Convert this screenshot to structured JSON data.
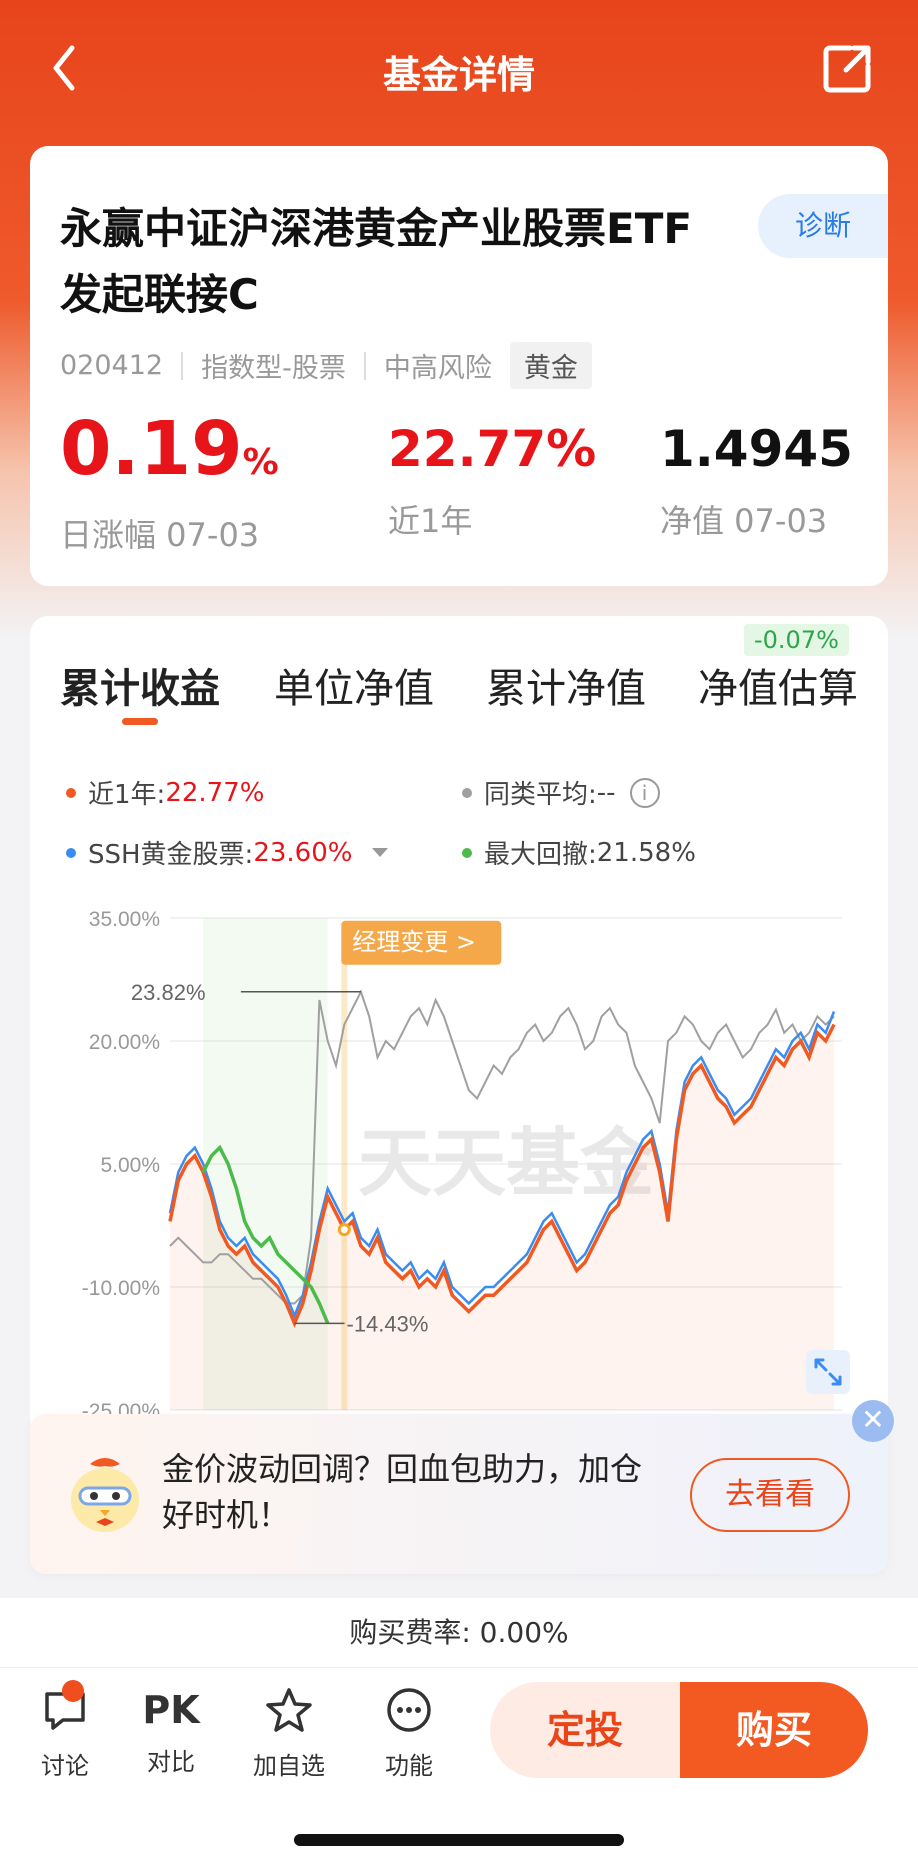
{
  "header": {
    "title": "基金详情"
  },
  "fund": {
    "name": "永赢中证沪深港黄金产业股票ETF发起联接C",
    "code": "020412",
    "type": "指数型-股票",
    "risk": "中高风险",
    "tag": "黄金",
    "diagnose_label": "诊断",
    "daily_change": "0.19",
    "daily_change_unit": "%",
    "daily_change_label": "日涨幅 07-03",
    "year_return": "22.77%",
    "year_return_label": "近1年",
    "nav": "1.4945",
    "nav_label": "净值 07-03"
  },
  "chart_tabs": {
    "tabs": [
      "累计收益",
      "单位净值",
      "累计净值",
      "净值估算"
    ],
    "active": 0,
    "estimate_badge": "-0.07%"
  },
  "legend": {
    "fund_label": "近1年:",
    "fund_value": "22.77%",
    "peer_label": "同类平均:",
    "peer_value": "--",
    "index_label": "SSH黄金股票:",
    "index_value": "23.60%",
    "drawdown_label": "最大回撤:",
    "drawdown_value": "21.58%"
  },
  "chart_data": {
    "type": "line",
    "y_ticks": [
      "35.00%",
      "20.00%",
      "5.00%",
      "-10.00%",
      "-25.00%"
    ],
    "ylim": [
      -25,
      35
    ],
    "annotations": {
      "manager_change": "经理变更 >",
      "max_label": "23.82%",
      "min_label": "-14.43%",
      "watermark": "天天基金"
    },
    "colors": {
      "fund": "#f05a22",
      "index": "#3b8cf0",
      "peer": "#a0a0a0",
      "drawdown": "#4cbb4c"
    },
    "series": [
      {
        "name": "近1年",
        "values": [
          -2,
          3,
          5,
          6,
          4,
          1,
          -3,
          -5,
          -6,
          -5,
          -7,
          -8,
          -9,
          -10,
          -12,
          -14.43,
          -12,
          -8,
          -3,
          1,
          -1,
          -3,
          -2,
          -5,
          -6,
          -4,
          -7,
          -8,
          -9,
          -8,
          -10,
          -9,
          -10,
          -8,
          -11,
          -12,
          -13,
          -12,
          -11,
          -11,
          -10,
          -9,
          -8,
          -7,
          -5,
          -3,
          -2,
          -4,
          -6,
          -8,
          -7,
          -5,
          -3,
          -1,
          0,
          3,
          5,
          7,
          8,
          4,
          -2,
          8,
          14,
          16,
          17,
          15,
          13,
          12,
          10,
          11,
          12,
          14,
          16,
          18,
          17,
          19,
          20,
          18,
          21,
          20,
          22
        ]
      },
      {
        "name": "SSH黄金股票",
        "values": [
          -1,
          4,
          6,
          7,
          5,
          2,
          -2,
          -4,
          -5,
          -4,
          -6,
          -7,
          -8,
          -9,
          -11,
          -13.5,
          -11,
          -7,
          -2,
          2,
          0,
          -2,
          -1,
          -4,
          -5,
          -3,
          -6,
          -7,
          -8,
          -7,
          -9,
          -8,
          -9,
          -7,
          -10,
          -11,
          -12,
          -11,
          -10,
          -10,
          -9,
          -8,
          -7,
          -6,
          -4,
          -2,
          -1,
          -3,
          -5,
          -7,
          -6,
          -4,
          -2,
          0,
          1,
          4,
          6,
          8,
          9,
          5,
          -1,
          9,
          15,
          17,
          18,
          16,
          14,
          13,
          11,
          12,
          13,
          15,
          17,
          19,
          18,
          20,
          21,
          19,
          22,
          21,
          23.6
        ]
      },
      {
        "name": "同类平均",
        "values": [
          -5,
          -4,
          -5,
          -6,
          -7,
          -7,
          -6,
          -6,
          -7,
          -8,
          -9,
          -9,
          -10,
          -11,
          -12,
          -12,
          -11,
          -4,
          25,
          20,
          17,
          22,
          24,
          26,
          23,
          18,
          20,
          19,
          21,
          23,
          24,
          22,
          25,
          23,
          20,
          17,
          14,
          13,
          15,
          17,
          16,
          18,
          19,
          21,
          22,
          20,
          21,
          23,
          24,
          22,
          19,
          20,
          23,
          24,
          22,
          21,
          17,
          15,
          13,
          10,
          20,
          21,
          23,
          22,
          20,
          19,
          21,
          22,
          20,
          18,
          19,
          21,
          22,
          23.82,
          21,
          22,
          20,
          21,
          23,
          22,
          23
        ]
      },
      {
        "name": "最大回撤",
        "values": [
          4,
          6,
          7,
          5,
          2,
          -2,
          -4,
          -5,
          -4,
          -6,
          -7,
          -8,
          -9,
          -10,
          -12,
          -14.43
        ]
      }
    ]
  },
  "promo": {
    "text": "金价波动回调？回血包助力，加仓好时机！",
    "button": "去看看",
    "close": "✕"
  },
  "fee": {
    "text": "购买费率: 0.00%"
  },
  "bottom": {
    "discuss": "讨论",
    "pk_icon": "PK",
    "compare": "对比",
    "watch": "加自选",
    "more": "功能",
    "sip": "定投",
    "buy": "购买"
  }
}
